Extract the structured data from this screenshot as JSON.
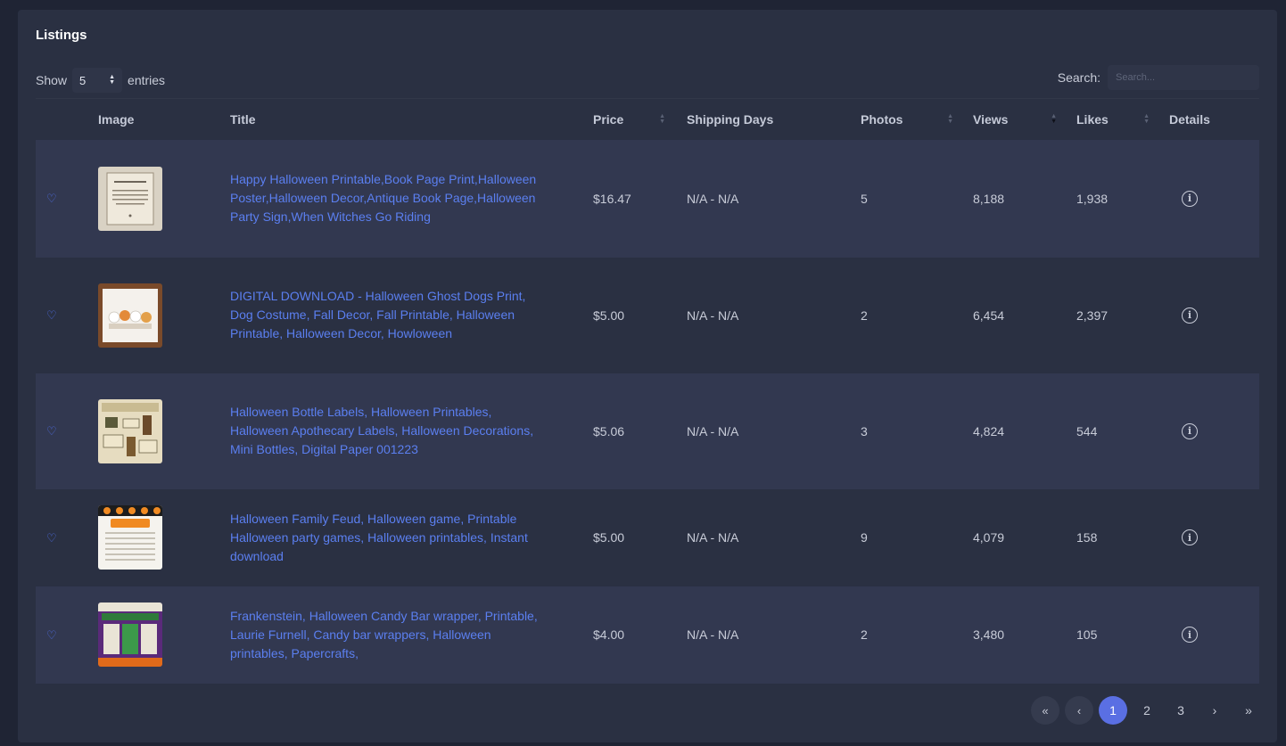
{
  "card": {
    "title": "Listings"
  },
  "length": {
    "show_label": "Show",
    "value": "5",
    "entries_label": "entries"
  },
  "search": {
    "label": "Search:",
    "placeholder": "Search..."
  },
  "columns": {
    "image": "Image",
    "title": "Title",
    "price": "Price",
    "shipping": "Shipping Days",
    "photos": "Photos",
    "views": "Views",
    "likes": "Likes",
    "details": "Details"
  },
  "rows": [
    {
      "title": "Happy Halloween Printable,Book Page Print,Halloween Poster,Halloween Decor,Antique Book Page,Halloween Party Sign,When Witches Go Riding",
      "price": "$16.47",
      "shipping": "N/A - N/A",
      "photos": "5",
      "views": "8,188",
      "likes": "1,938"
    },
    {
      "title": "DIGITAL DOWNLOAD - Halloween Ghost Dogs Print, Dog Costume, Fall Decor, Fall Printable, Halloween Printable, Halloween Decor, Howloween",
      "price": "$5.00",
      "shipping": "N/A - N/A",
      "photos": "2",
      "views": "6,454",
      "likes": "2,397"
    },
    {
      "title": "Halloween Bottle Labels, Halloween Printables, Halloween Apothecary Labels, Halloween Decorations, Mini Bottles, Digital Paper 001223",
      "price": "$5.06",
      "shipping": "N/A - N/A",
      "photos": "3",
      "views": "4,824",
      "likes": "544"
    },
    {
      "title": "Halloween Family Feud, Halloween game, Printable Halloween party games, Halloween printables, Instant download",
      "price": "$5.00",
      "shipping": "N/A - N/A",
      "photos": "9",
      "views": "4,079",
      "likes": "158"
    },
    {
      "title": "Frankenstein, Halloween Candy Bar wrapper, Printable, Laurie Furnell, Candy bar wrappers, Halloween printables, Papercrafts,",
      "price": "$4.00",
      "shipping": "N/A - N/A",
      "photos": "2",
      "views": "3,480",
      "likes": "105"
    }
  ],
  "pagination": {
    "first": "«",
    "prev": "‹",
    "pages": [
      "1",
      "2",
      "3"
    ],
    "next": "›",
    "last": "»",
    "active": "1"
  },
  "icons": {
    "favorite": "heart-outline-icon",
    "details": "info-circle-icon"
  },
  "colors": {
    "accent": "#5a6fe3",
    "link": "#5b7ff0",
    "card": "#2a3042",
    "page": "#1f2434"
  }
}
